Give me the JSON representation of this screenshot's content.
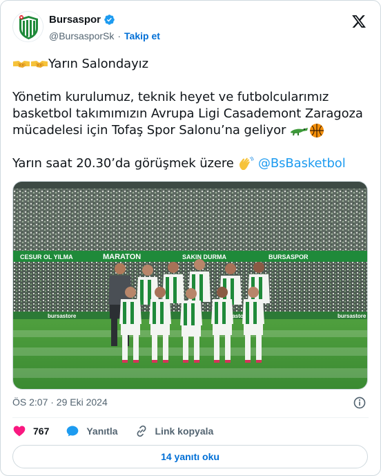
{
  "account": {
    "name": "Bursaspor",
    "handle": "@BursasporSk",
    "separator": "·",
    "follow_label": "Takip et",
    "verified": true
  },
  "tweet": {
    "line1": "Yarın Salondayız",
    "line2": "Yönetim kurulumuz, teknik heyet ve futbolcularımız",
    "line3": "basketbol takımımızın Avrupa Ligi Casademont Zaragoza",
    "line4": "mücadelesi için Tofaş Spor Salonu’na geliyor",
    "line5": "Yarın saat 20.30’da görüşmek üzere",
    "mention": "@BsBasketbol"
  },
  "emojis": {
    "line1": "handshake-icon",
    "line4": [
      "crocodile-icon",
      "basketball-icon"
    ],
    "line5": "waving-hand-icon"
  },
  "media": {
    "stadium_banners": [
      "CESUR OL YILMA",
      "MARATON",
      "SAKIN DURMA",
      "BURSASPOR"
    ],
    "ad_boards": [
      "bursastore",
      "bursastore",
      "bursastore"
    ]
  },
  "meta": {
    "timestamp": "ÖS 2:07 · 29 Eki 2024"
  },
  "actions": {
    "likes": "767",
    "reply_label": "Yanıtla",
    "copy_label": "Link kopyala"
  },
  "replies_button": "14 yanıtı oku",
  "colors": {
    "accent": "#1d9bf0",
    "link": "#006fd6",
    "like": "#f91880",
    "muted": "#536471",
    "pitch": "#3f9a3a",
    "club_green": "#1f8a3a"
  }
}
